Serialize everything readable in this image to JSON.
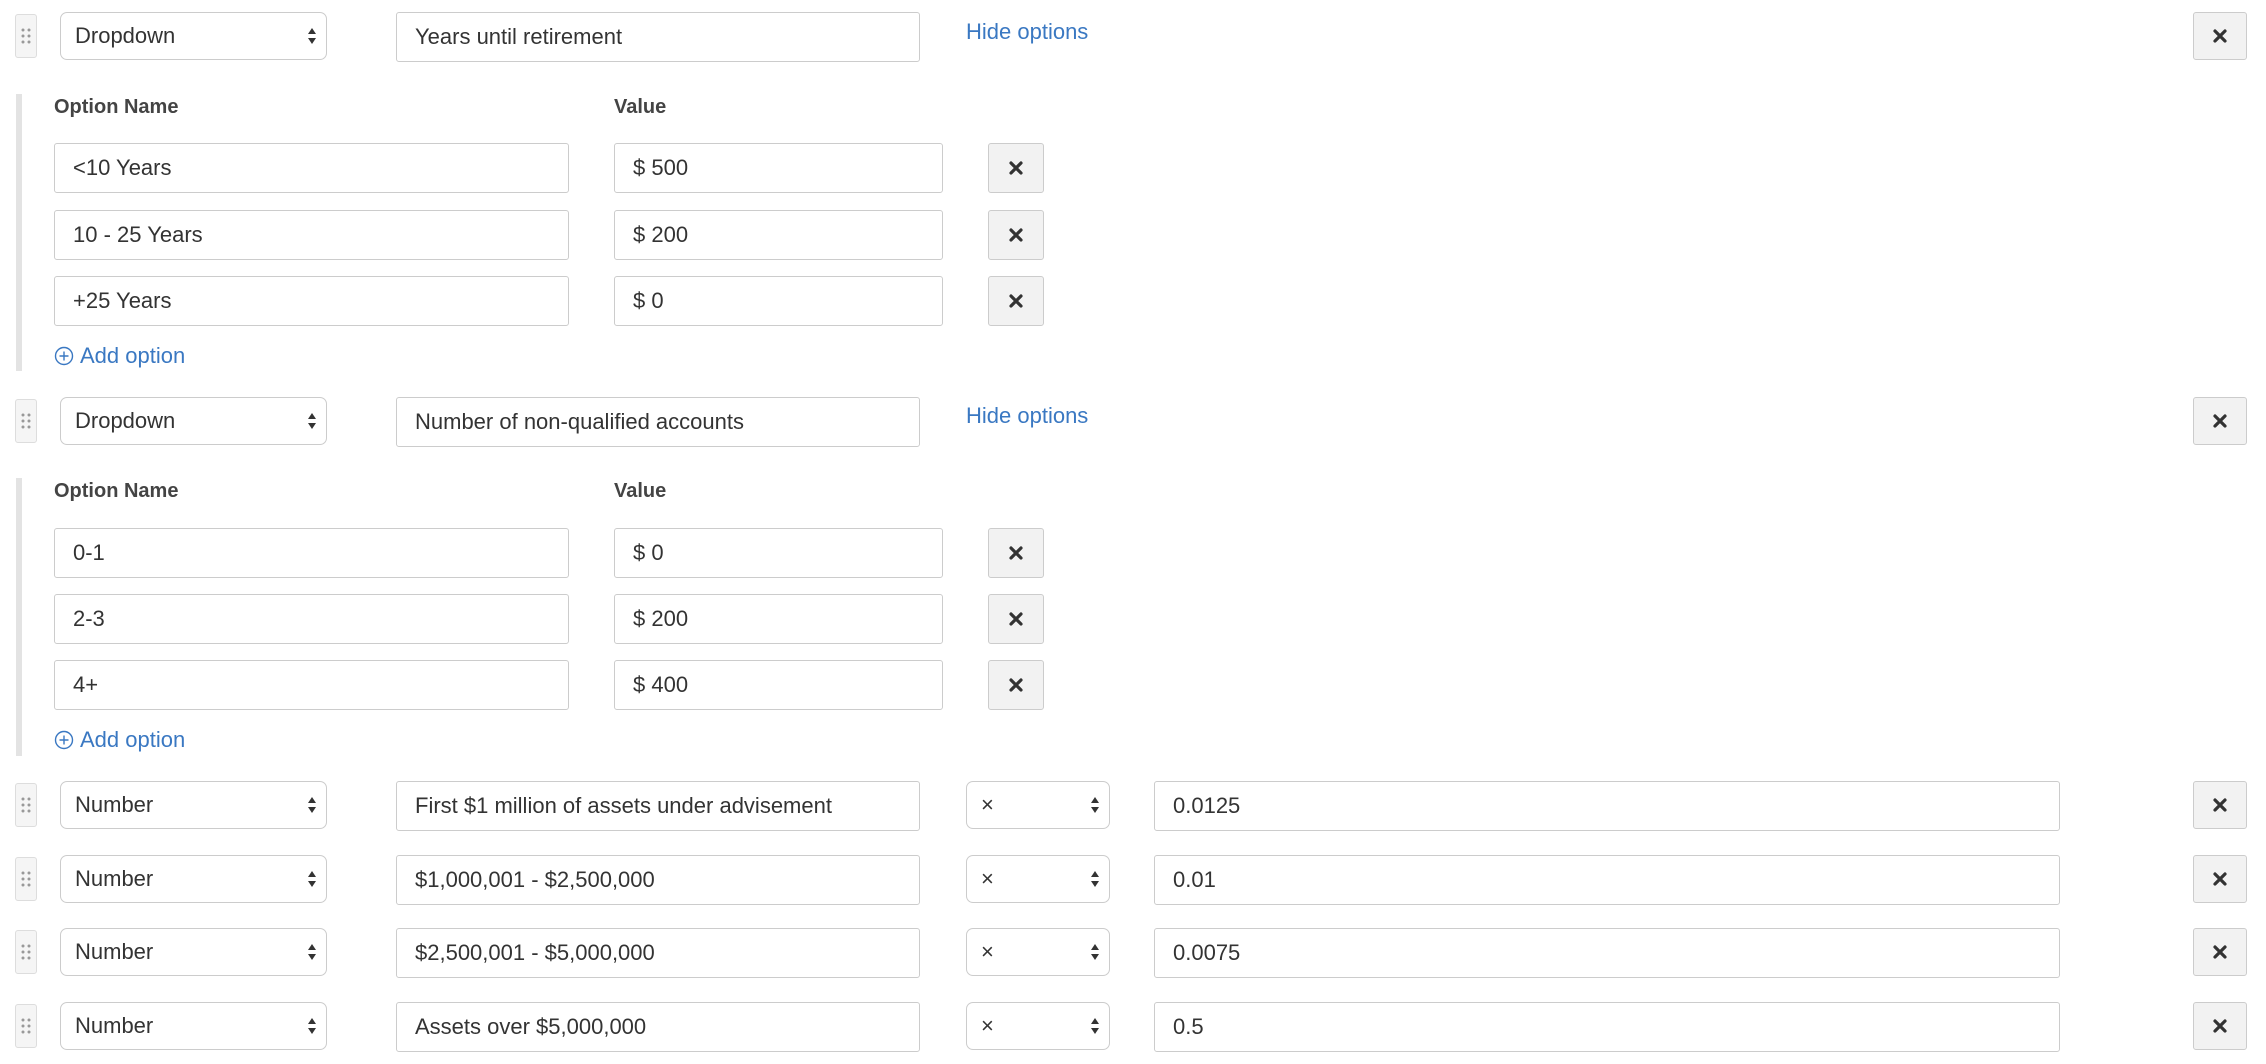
{
  "blocks": [
    {
      "type": "Dropdown",
      "label": "Years until retirement",
      "toggle": "Hide options",
      "option_name_header": "Option Name",
      "value_header": "Value",
      "options": [
        {
          "name": "<10 Years",
          "value": "$ 500"
        },
        {
          "name": "10 - 25 Years",
          "value": "$ 200"
        },
        {
          "name": "+25 Years",
          "value": "$ 0"
        }
      ],
      "add_option": "Add option"
    },
    {
      "type": "Dropdown",
      "label": "Number of non-qualified accounts",
      "toggle": "Hide options",
      "option_name_header": "Option Name",
      "value_header": "Value",
      "options": [
        {
          "name": "0-1",
          "value": "$ 0"
        },
        {
          "name": "2-3",
          "value": "$ 200"
        },
        {
          "name": "4+",
          "value": "$ 400"
        }
      ],
      "add_option": "Add option"
    }
  ],
  "number_rows": [
    {
      "type": "Number",
      "label": "First $1 million of assets under advisement",
      "operator": "×",
      "value": "0.0125"
    },
    {
      "type": "Number",
      "label": "$1,000,001 - $2,500,000",
      "operator": "×",
      "value": "0.01"
    },
    {
      "type": "Number",
      "label": "$2,500,001 - $5,000,000",
      "operator": "×",
      "value": "0.0075"
    },
    {
      "type": "Number",
      "label": "Assets over $5,000,000",
      "operator": "×",
      "value": "0.5"
    }
  ],
  "icons": {
    "drag": "drag-handle-icon",
    "close": "close-icon",
    "add": "plus-circle-icon",
    "select_arrows": "select-arrows-icon"
  },
  "colors": {
    "link": "#3a78c2",
    "border": "#cccccc",
    "button_bg": "#f2f2f2"
  }
}
